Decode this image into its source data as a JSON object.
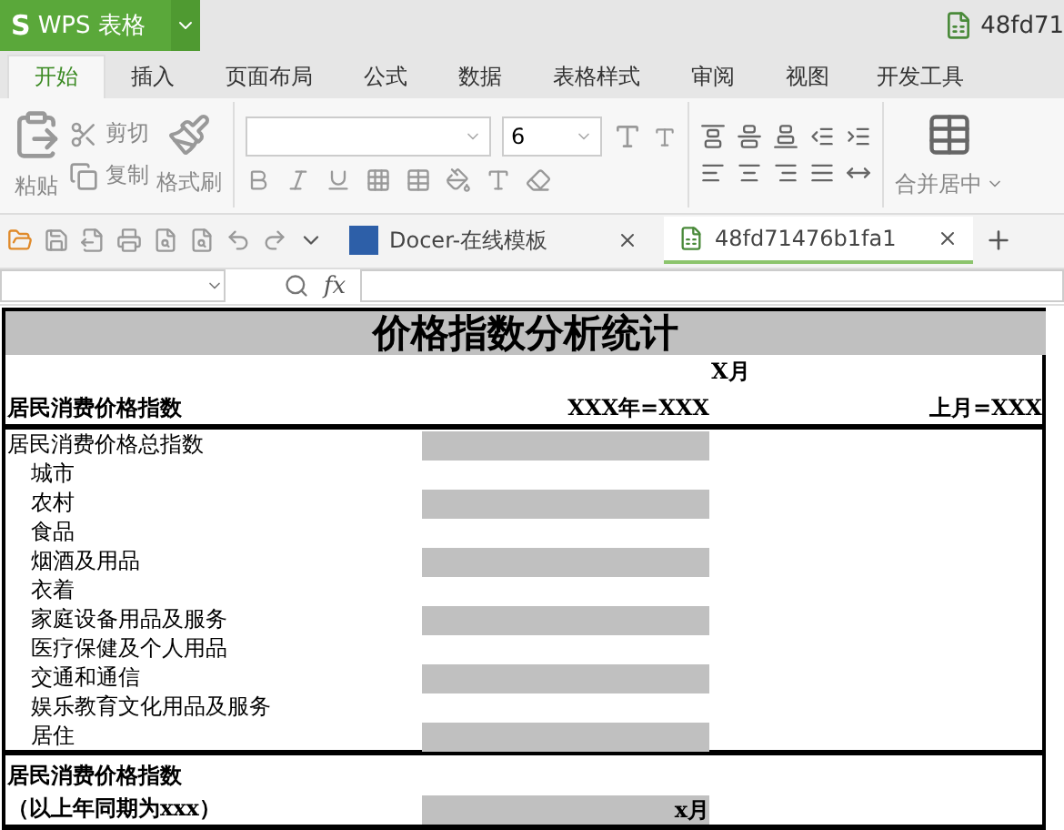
{
  "app": {
    "logo": "S",
    "title": "WPS 表格",
    "file_name": "48fd71"
  },
  "tabs": [
    {
      "label": "开始",
      "selected": true
    },
    {
      "label": "插入",
      "selected": false
    },
    {
      "label": "页面布局",
      "selected": false
    },
    {
      "label": "公式",
      "selected": false
    },
    {
      "label": "数据",
      "selected": false
    },
    {
      "label": "表格样式",
      "selected": false
    },
    {
      "label": "审阅",
      "selected": false
    },
    {
      "label": "视图",
      "selected": false
    },
    {
      "label": "开发工具",
      "selected": false
    }
  ],
  "ribbon": {
    "paste": "粘贴",
    "cut": "剪切",
    "copy": "复制",
    "format_painter": "格式刷",
    "font_size": "6",
    "merge": "合并居中"
  },
  "doc_tabs": [
    {
      "label": "Docer-在线模板",
      "selected": false
    },
    {
      "label": "48fd71476b1fa1",
      "selected": true
    }
  ],
  "formula_bar": {
    "fx": "fx"
  },
  "sheet": {
    "title": "价格指数分析统计",
    "month": "X月",
    "header": {
      "label": "居民消费价格指数",
      "base": "XXX年=XXX",
      "previous": "上月=XXX"
    },
    "rows": [
      {
        "label": "居民消费价格总指数",
        "shaded": true,
        "children": [
          {
            "label": "城市",
            "shaded": false
          },
          {
            "label": "农村",
            "shaded": true
          },
          {
            "label": "食品",
            "shaded": false
          },
          {
            "label": "烟酒及用品",
            "shaded": true
          },
          {
            "label": "衣着",
            "shaded": false
          },
          {
            "label": "家庭设备用品及服务",
            "shaded": true
          },
          {
            "label": "医疗保健及个人用品",
            "shaded": false
          },
          {
            "label": "交通和通信",
            "shaded": true
          },
          {
            "label": "娱乐教育文化用品及服务",
            "shaded": false
          },
          {
            "label": "居住",
            "shaded": true
          }
        ]
      }
    ],
    "section": {
      "label": "居民消费价格指数",
      "sublabel": "（以上年同期为xxx）",
      "month": "x月"
    }
  }
}
